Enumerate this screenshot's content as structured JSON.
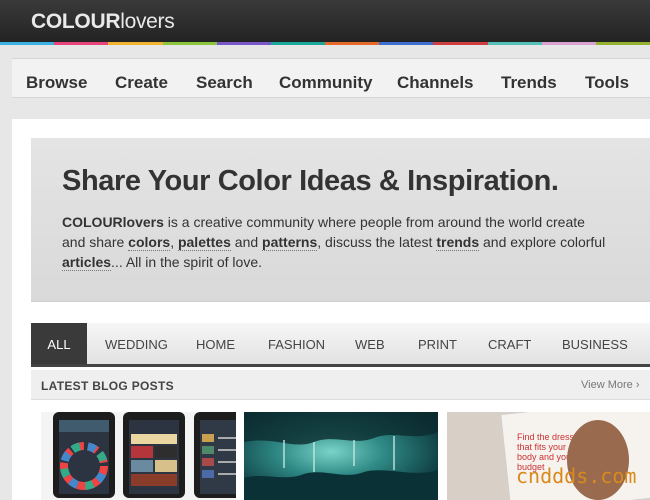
{
  "logo": {
    "bold": "COLOUR",
    "light": "lovers"
  },
  "rainbow_colors": [
    "#3cb0e0",
    "#e8447a",
    "#f0b430",
    "#8cc63e",
    "#7a57c8",
    "#1aa89a",
    "#e86a2a",
    "#3c6fd0",
    "#cf3f3f",
    "#55c0b8",
    "#d9a3cf",
    "#95b22e"
  ],
  "nav": {
    "items": [
      "Browse",
      "Create",
      "Search",
      "Community",
      "Channels",
      "Trends",
      "Tools"
    ]
  },
  "hero": {
    "title": "Share Your Color Ideas & Inspiration.",
    "l1_a": "COLOURlovers",
    "l1_b": " is a creative community where people from around the world create",
    "l2_a": "and share ",
    "l2_colors": "colors",
    "l2_sep1": ", ",
    "l2_palettes": "palettes",
    "l2_and": " and ",
    "l2_patterns": "patterns",
    "l2_mid": ", discuss the latest ",
    "l2_trends": "trends",
    "l2_end": " and explore colorful",
    "l3_articles": "articles",
    "l3_end": "... All in the spirit of love."
  },
  "tabs": [
    "ALL",
    "WEDDING",
    "HOME",
    "FASHION",
    "WEB",
    "PRINT",
    "CRAFT",
    "BUSINESS"
  ],
  "blog": {
    "title": "LATEST BLOG POSTS",
    "view_more": "View More ›"
  },
  "magazine_text": "Find the dress that fits your body and your budget",
  "watermark": "cnddds.com"
}
